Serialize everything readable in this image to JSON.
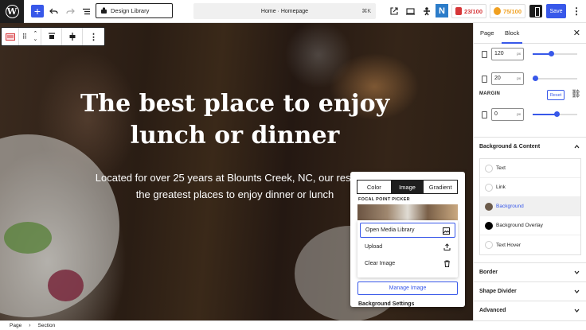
{
  "topbar": {
    "design_library_label": "Design Library",
    "document_title": "Home · Homepage",
    "shortcut": "⌘K",
    "score_red": "23/100",
    "score_orange": "75/100",
    "n_logo": "N",
    "save_label": "Save"
  },
  "hero": {
    "title": "The best place to enjoy lunch or dinner",
    "subtitle_line1": "Located for over 25 years at Blounts Creek, NC, our restaura",
    "subtitle_line2": "the greatest places to enjoy dinner or lunch"
  },
  "popover": {
    "tabs": [
      "Color",
      "Image",
      "Gradient"
    ],
    "active_tab": "Image",
    "focal_point_label": "FOCAL POINT PICKER",
    "media_menu": [
      "Open Media Library",
      "Upload",
      "Clear Image"
    ],
    "manage_image_label": "Manage Image",
    "background_settings_label": "Background Settings"
  },
  "sidebar": {
    "tabs": [
      "Page",
      "Block"
    ],
    "active_tab": "Block",
    "rows": [
      {
        "value": "120",
        "unit": "px",
        "slider_fraction": 0.42
      },
      {
        "value": "20",
        "unit": "px",
        "slider_fraction": 0.07
      }
    ],
    "margin_label": "MARGIN",
    "reset_label": "Reset",
    "margin_row": {
      "value": "0",
      "unit": "px",
      "slider_fraction": 0.55
    },
    "bg_content_title": "Background & Content",
    "color_items": [
      {
        "label": "Text",
        "color": "#ffffff"
      },
      {
        "label": "Link",
        "color": "#ffffff"
      },
      {
        "label": "Background",
        "color": "#6b5a4a"
      },
      {
        "label": "Background Overlay",
        "color": "#000000"
      },
      {
        "label": "Text Hover",
        "color": "#ffffff"
      }
    ],
    "sections": [
      "Border",
      "Shape Divider",
      "Advanced"
    ]
  },
  "footer": {
    "crumbs": [
      "Page",
      "Section"
    ]
  },
  "colors": {
    "accent": "#3858e9",
    "dark": "#1e1e1e"
  }
}
